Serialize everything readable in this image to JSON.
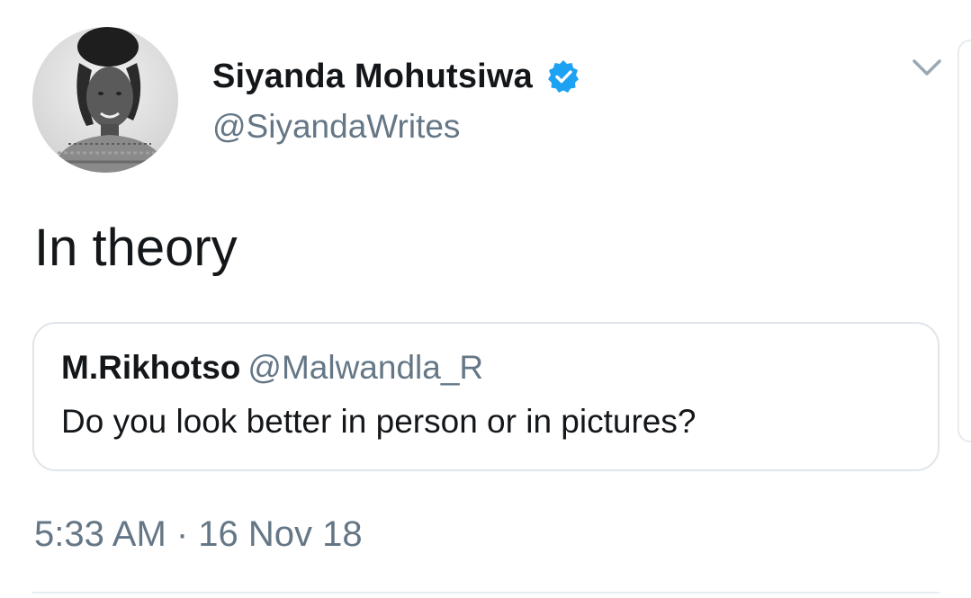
{
  "author": {
    "display_name": "Siyanda Mohutsiwa",
    "handle": "@SiyandaWrites",
    "verified": true
  },
  "tweet": {
    "text": "In theory",
    "timestamp": "5:33 AM · 16 Nov 18"
  },
  "quoted_tweet": {
    "display_name": "M.Rikhotso",
    "handle": "@Malwandla_R",
    "text": "Do you look better in person or in pictures?"
  },
  "icons": {
    "verified": "verified-badge-icon",
    "caret": "chevron-down-icon"
  },
  "colors": {
    "verified_blue": "#1da1f2",
    "secondary_text": "#657786",
    "primary_text": "#14171a",
    "border": "#dfe5ea"
  }
}
